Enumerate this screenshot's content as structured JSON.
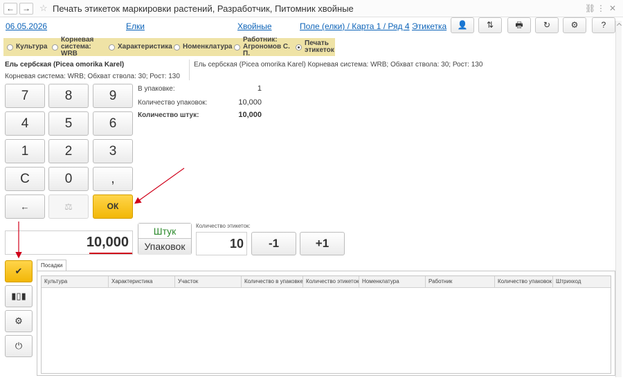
{
  "window": {
    "title": "Печать этикеток маркировки растений, Разработчик, Питомник хвойные"
  },
  "header": {
    "date": "06.05.2026",
    "crop": "Елки",
    "group": "Хвойные",
    "location": "Поле (елки) / Карта 1 / Ряд 4",
    "mode": "Этикетка",
    "help_label": "?"
  },
  "steps": [
    {
      "label": "Культура",
      "selected": false
    },
    {
      "label": "Корневая система: WRB",
      "selected": false
    },
    {
      "label": "Характеристика",
      "selected": false
    },
    {
      "label": "Номенклатура",
      "selected": false
    },
    {
      "label": "Работник: Агрономов С. П.",
      "selected": false
    },
    {
      "label": "Печать этикеток",
      "selected": true
    }
  ],
  "plant": {
    "name": "Ель сербская (Picea omorika Karel)",
    "description": "Корневая система: WRB; Обхват ствола: 30; Рост: 130",
    "full": "Ель сербская (Picea omorika Karel) Корневая система: WRB; Обхват ствола: 30; Рост: 130"
  },
  "keypad": {
    "keys": [
      "7",
      "8",
      "9",
      "4",
      "5",
      "6",
      "1",
      "2",
      "3",
      "C",
      "0",
      ","
    ],
    "backspace": "←",
    "scale": "⚖",
    "ok": "ОК"
  },
  "values": {
    "per_pack_label": "В упаковке:",
    "per_pack_value": "1",
    "packs_label": "Количество упаковок:",
    "packs_value": "10,000",
    "pieces_label": "Количество штук:",
    "pieces_value": "10,000"
  },
  "input": {
    "display_value": "10,000",
    "unit_pieces": "Штук",
    "unit_packs": "Упаковок",
    "label_count_caption": "Количество этикеток:",
    "label_count_value": "10",
    "minus_label": "-1",
    "plus_label": "+1"
  },
  "tabs": [
    {
      "label": "Посадки",
      "active": true
    }
  ],
  "table": {
    "columns": [
      "Культура",
      "Характеристика",
      "Участок",
      "Количество в упаковке",
      "Количество этикеток",
      "Номенклатура",
      "Работник",
      "Количество упаковок",
      "Штрихкод"
    ],
    "rows": []
  },
  "colors": {
    "accent_yellow": "#f2b707",
    "steps_bg": "#efe3a6",
    "link_blue": "#0c63b8",
    "annotation_red": "#d0021b",
    "unit_green": "#2d8a2d"
  }
}
